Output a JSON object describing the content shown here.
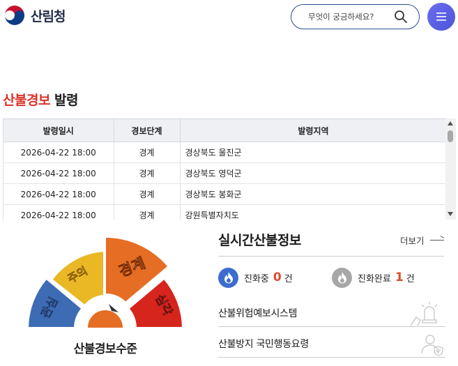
{
  "header": {
    "logo_text": "산림청",
    "search_placeholder": "무엇이 궁금하세요?"
  },
  "alert": {
    "title_highlight": "산불경보",
    "title_rest": "발령",
    "columns": [
      "발령일시",
      "경보단계",
      "발령지역"
    ],
    "rows": [
      {
        "datetime": "2026-04-22 18:00",
        "level": "경계",
        "region": "경상북도 울진군"
      },
      {
        "datetime": "2026-04-22 18:00",
        "level": "경계",
        "region": "경상북도 영덕군"
      },
      {
        "datetime": "2026-04-22 18:00",
        "level": "경계",
        "region": "경상북도 봉화군"
      },
      {
        "datetime": "2026-04-22 18:00",
        "level": "경계",
        "region": "강원특별자치도"
      }
    ]
  },
  "gauge": {
    "caption": "산불경보수준",
    "levels": [
      {
        "label": "관심",
        "color": "#3d6cb5"
      },
      {
        "label": "주의",
        "color": "#e9b824"
      },
      {
        "label": "경계",
        "color": "#e56d24"
      },
      {
        "label": "심각",
        "color": "#d6251d"
      }
    ],
    "current_level": "경계"
  },
  "realtime": {
    "title": "실시간산불정보",
    "more_label": "더보기",
    "in_progress": {
      "label": "진화중",
      "count": "0",
      "unit": "건",
      "color": "#3d6cd0"
    },
    "completed": {
      "label": "진화완료",
      "count": "1",
      "unit": "건",
      "color": "#a7a7a7"
    },
    "links": [
      {
        "label": "산불위험예보시스템",
        "icon": "siren-icon"
      },
      {
        "label": "산불방지 국민행동요령",
        "icon": "person-shield-icon"
      }
    ]
  }
}
